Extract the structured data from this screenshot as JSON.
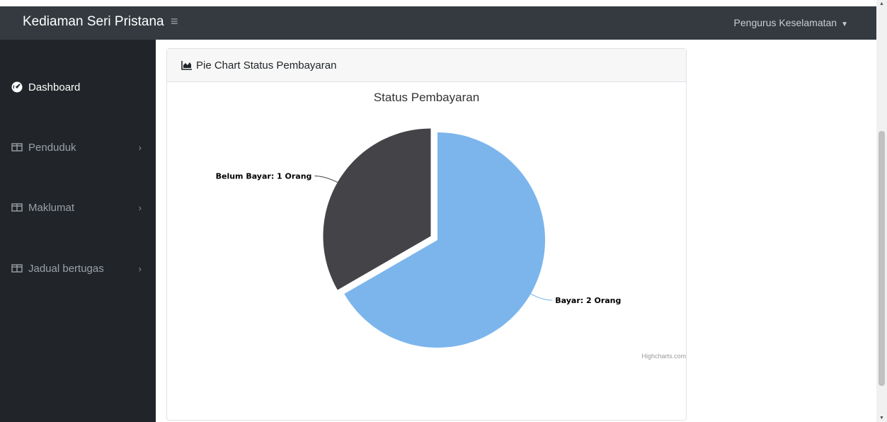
{
  "app": {
    "title": "Kediaman Seri Pristana",
    "menu_icon": "hamburger-icon",
    "user_label": "Pengurus Keselamatan"
  },
  "sidebar": {
    "items": [
      {
        "label": "Dashboard",
        "icon": "dashboard-gauge-icon",
        "active": true
      },
      {
        "label": "Penduduk",
        "icon": "table-icon",
        "has_submenu": true
      },
      {
        "label": "Maklumat",
        "icon": "table-icon",
        "has_submenu": true
      },
      {
        "label": "Jadual bertugas",
        "icon": "table-icon",
        "has_submenu": true
      }
    ],
    "chevron": "›"
  },
  "card": {
    "header": "Pie Chart Status Pembayaran",
    "header_icon": "area-chart-icon"
  },
  "chart_data": {
    "type": "pie",
    "title": "Status Pembayaran",
    "slices": [
      {
        "name": "Bayar",
        "value": 2,
        "label": "Bayar: 2 Orang",
        "color": "#7cb5ec",
        "sliced": false
      },
      {
        "name": "Belum Bayar",
        "value": 1,
        "label": "Belum Bayar: 1 Orang",
        "color": "#434348",
        "sliced": true
      }
    ],
    "credits": "Highcharts.com"
  }
}
